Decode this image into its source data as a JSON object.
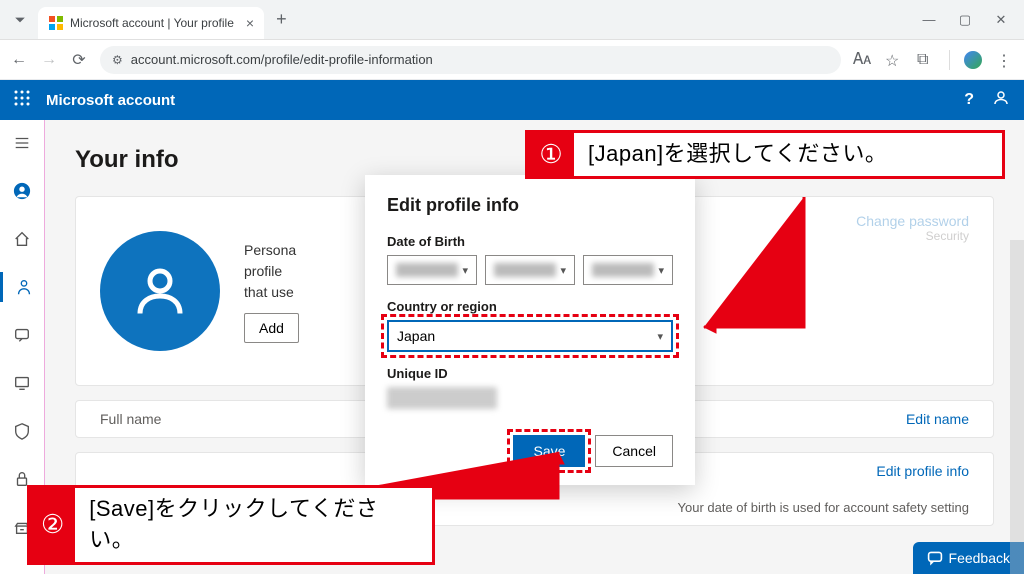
{
  "browser": {
    "tab_title": "Microsoft account | Your profile",
    "url": "account.microsoft.com/profile/edit-profile-information"
  },
  "header": {
    "brand": "Microsoft account"
  },
  "page": {
    "title": "Your info",
    "personal_text_line1": "Persona",
    "personal_text_line2": "profile",
    "personal_text_line3": "that use",
    "add_button": "Add",
    "full_name_label": "Full name",
    "edit_name_link": "Edit name",
    "edit_profile_link": "Edit profile info",
    "dob_note": "Your date of birth is used for account safety setting",
    "feedback": "Feedback",
    "side_change_password": "Change password",
    "side_security": "Security"
  },
  "modal": {
    "title": "Edit profile info",
    "dob_label": "Date of Birth",
    "country_label": "Country or region",
    "country_value": "Japan",
    "uniqueid_label": "Unique ID",
    "save": "Save",
    "cancel": "Cancel"
  },
  "annotations": {
    "a1_num": "①",
    "a1_text": "[Japan]を選択してください。",
    "a2_num": "②",
    "a2_text": "[Save]をクリックしてください。"
  }
}
